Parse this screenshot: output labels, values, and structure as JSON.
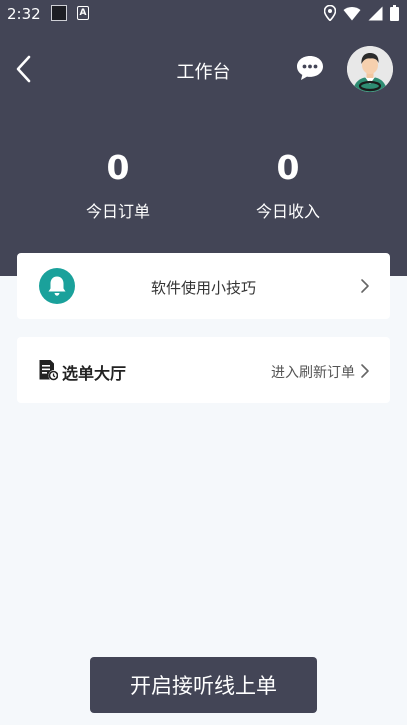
{
  "status_bar": {
    "time": "2:32",
    "icons": [
      "notification-square-icon",
      "a-app-icon",
      "location-icon",
      "wifi-icon",
      "signal-icon",
      "battery-icon"
    ]
  },
  "nav": {
    "title": "工作台",
    "back_icon": "chevron-left-icon",
    "chat_icon": "chat-bubble-icon",
    "avatar": "driver-avatar"
  },
  "stats": {
    "today_orders": {
      "value": "0",
      "label": "今日订单"
    },
    "today_income": {
      "value": "0",
      "label": "今日收入"
    }
  },
  "tips_card": {
    "label": "软件使用小技巧",
    "icon": "bell-icon"
  },
  "hall_card": {
    "label": "选单大厅",
    "action": "进入刷新订单",
    "icon": "document-clock-icon"
  },
  "start_button": {
    "label": "开启接听线上单"
  },
  "colors": {
    "header_bg": "#434556",
    "page_bg": "#f5f8fb",
    "accent_teal": "#1aa19b",
    "button_bg": "#434556"
  }
}
